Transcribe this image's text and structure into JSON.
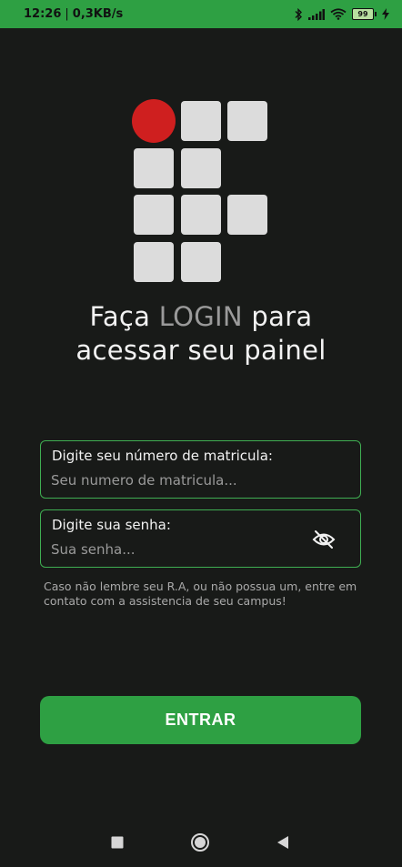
{
  "status_bar": {
    "time": "12:26",
    "separator": "|",
    "network_speed": "0,3KB/s",
    "battery_level": "99",
    "icons": [
      "bluetooth-icon",
      "signal-icon",
      "wifi-icon",
      "battery-icon",
      "charging-icon"
    ]
  },
  "logo": {
    "name": "institution-logo",
    "accent_color": "#cf1f1f",
    "tile_color": "#dcdcdc"
  },
  "heading": {
    "line1_prefix": "Faça ",
    "line1_emphasis": "LOGIN",
    "line1_suffix": " para",
    "line2": "acessar seu painel"
  },
  "form": {
    "registration": {
      "label": "Digite seu número de matricula:",
      "placeholder": "Seu numero de matricula...",
      "value": ""
    },
    "password": {
      "label": "Digite sua senha:",
      "placeholder": "Sua senha...",
      "value": "",
      "toggle_icon": "eye-off-icon"
    },
    "hint": "Caso não lembre seu R.A, ou não possua um, entre em contato com a assistencia de seu campus!",
    "submit_label": "ENTRAR"
  },
  "nav_bar": {
    "buttons": [
      "recents-icon",
      "home-icon",
      "back-icon"
    ]
  },
  "colors": {
    "background": "#181a18",
    "accent": "#2ea043",
    "field_border": "#3fae52",
    "text": "#f2f2f2",
    "muted_text": "#9a9a9a"
  }
}
